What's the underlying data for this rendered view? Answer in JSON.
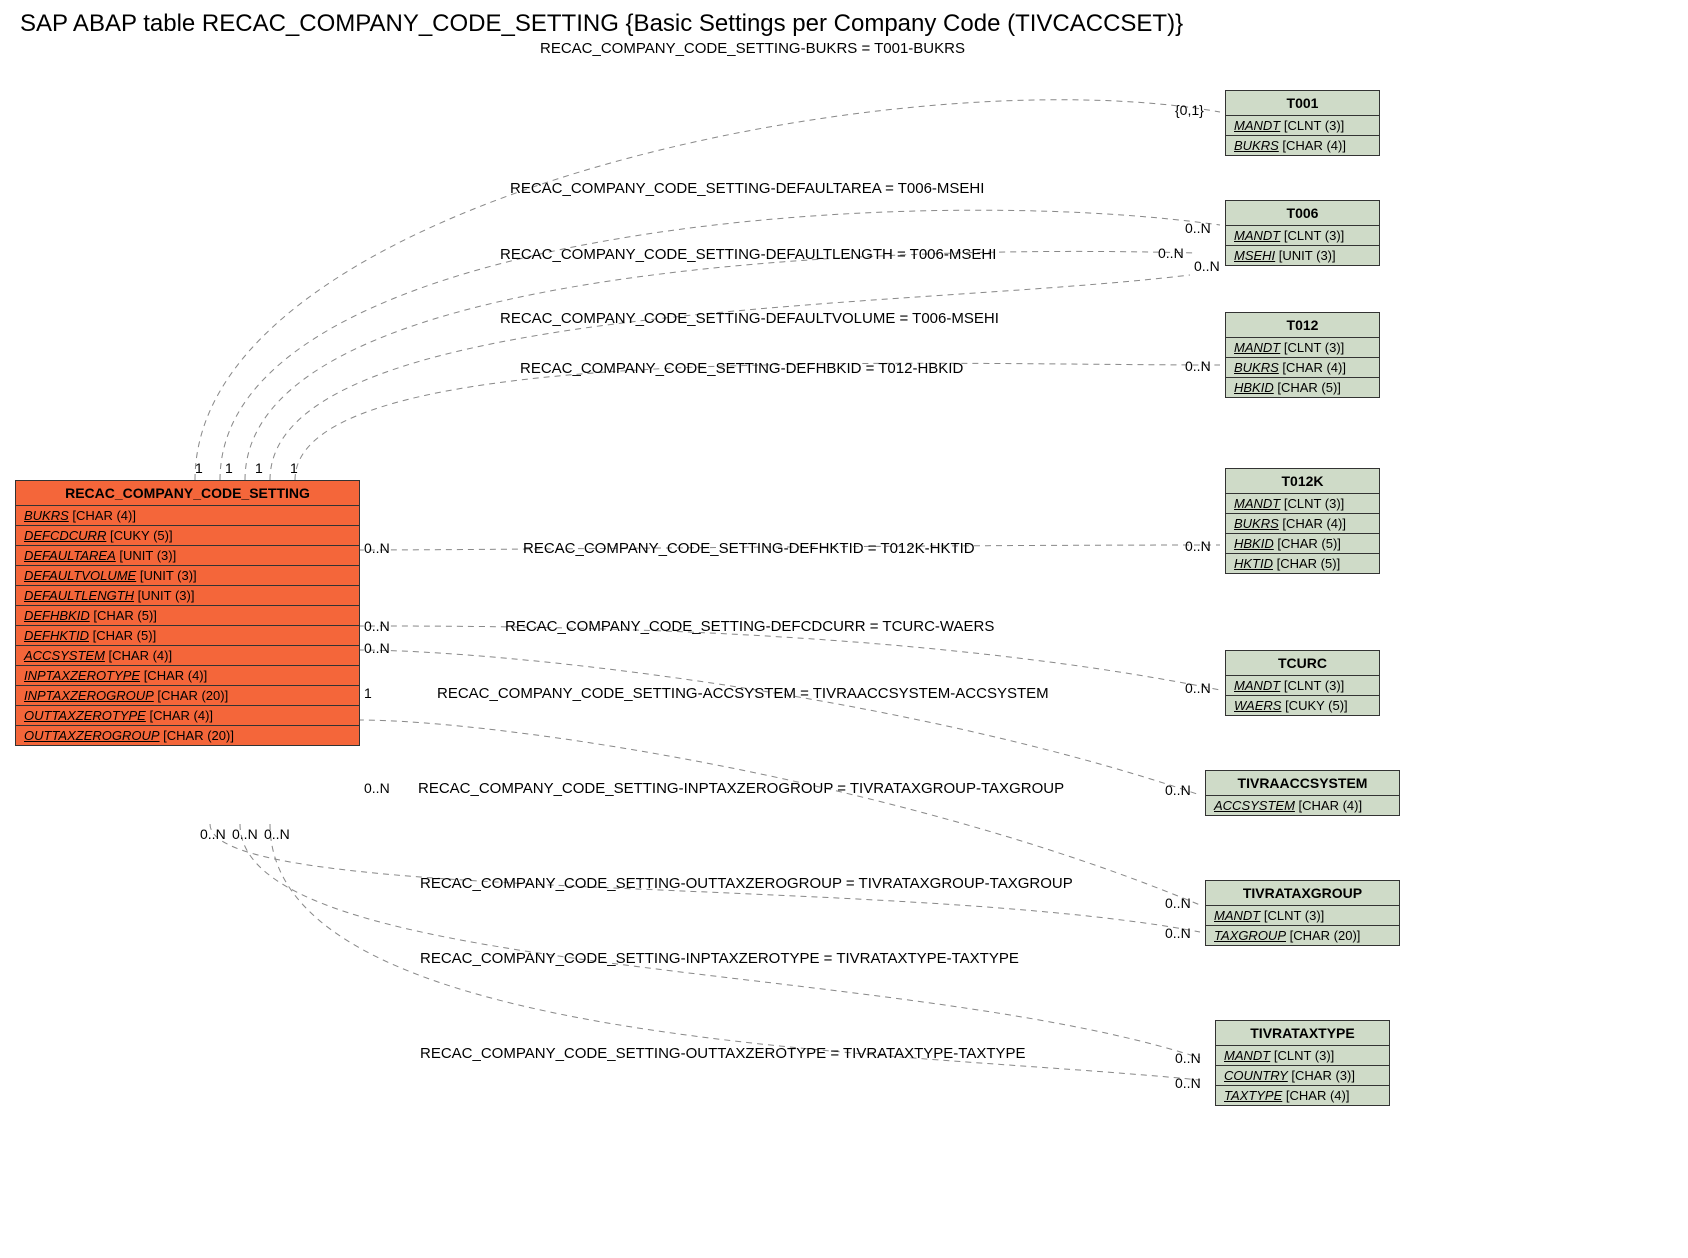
{
  "title": "SAP ABAP table RECAC_COMPANY_CODE_SETTING {Basic Settings per Company Code (TIVCACCSET)}",
  "main": {
    "name": "RECAC_COMPANY_CODE_SETTING",
    "fields": [
      {
        "name": "BUKRS",
        "type": "[CHAR (4)]"
      },
      {
        "name": "DEFCDCURR",
        "type": "[CUKY (5)]"
      },
      {
        "name": "DEFAULTAREA",
        "type": "[UNIT (3)]"
      },
      {
        "name": "DEFAULTVOLUME",
        "type": "[UNIT (3)]"
      },
      {
        "name": "DEFAULTLENGTH",
        "type": "[UNIT (3)]"
      },
      {
        "name": "DEFHBKID",
        "type": "[CHAR (5)]"
      },
      {
        "name": "DEFHKTID",
        "type": "[CHAR (5)]"
      },
      {
        "name": "ACCSYSTEM",
        "type": "[CHAR (4)]"
      },
      {
        "name": "INPTAXZEROTYPE",
        "type": "[CHAR (4)]"
      },
      {
        "name": "INPTAXZEROGROUP",
        "type": "[CHAR (20)]"
      },
      {
        "name": "OUTTAXZEROTYPE",
        "type": "[CHAR (4)]"
      },
      {
        "name": "OUTTAXZEROGROUP",
        "type": "[CHAR (20)]"
      }
    ]
  },
  "refs": {
    "t001": {
      "name": "T001",
      "fields": [
        {
          "name": "MANDT",
          "type": "[CLNT (3)]"
        },
        {
          "name": "BUKRS",
          "type": "[CHAR (4)]"
        }
      ]
    },
    "t006": {
      "name": "T006",
      "fields": [
        {
          "name": "MANDT",
          "type": "[CLNT (3)]"
        },
        {
          "name": "MSEHI",
          "type": "[UNIT (3)]"
        }
      ]
    },
    "t012": {
      "name": "T012",
      "fields": [
        {
          "name": "MANDT",
          "type": "[CLNT (3)]"
        },
        {
          "name": "BUKRS",
          "type": "[CHAR (4)]"
        },
        {
          "name": "HBKID",
          "type": "[CHAR (5)]"
        }
      ]
    },
    "t012k": {
      "name": "T012K",
      "fields": [
        {
          "name": "MANDT",
          "type": "[CLNT (3)]"
        },
        {
          "name": "BUKRS",
          "type": "[CHAR (4)]"
        },
        {
          "name": "HBKID",
          "type": "[CHAR (5)]"
        },
        {
          "name": "HKTID",
          "type": "[CHAR (5)]"
        }
      ]
    },
    "tcurc": {
      "name": "TCURC",
      "fields": [
        {
          "name": "MANDT",
          "type": "[CLNT (3)]"
        },
        {
          "name": "WAERS",
          "type": "[CUKY (5)]"
        }
      ]
    },
    "tivraaccsystem": {
      "name": "TIVRAACCSYSTEM",
      "fields": [
        {
          "name": "ACCSYSTEM",
          "type": "[CHAR (4)]"
        }
      ]
    },
    "tivrataxgroup": {
      "name": "TIVRATAXGROUP",
      "fields": [
        {
          "name": "MANDT",
          "type": "[CLNT (3)]"
        },
        {
          "name": "TAXGROUP",
          "type": "[CHAR (20)]"
        }
      ]
    },
    "tivrataxtype": {
      "name": "TIVRATAXTYPE",
      "fields": [
        {
          "name": "MANDT",
          "type": "[CLNT (3)]"
        },
        {
          "name": "COUNTRY",
          "type": "[CHAR (3)]"
        },
        {
          "name": "TAXTYPE",
          "type": "[CHAR (4)]"
        }
      ]
    }
  },
  "relations": {
    "r1": "RECAC_COMPANY_CODE_SETTING-BUKRS = T001-BUKRS",
    "r2": "RECAC_COMPANY_CODE_SETTING-DEFAULTAREA = T006-MSEHI",
    "r3": "RECAC_COMPANY_CODE_SETTING-DEFAULTLENGTH = T006-MSEHI",
    "r4": "RECAC_COMPANY_CODE_SETTING-DEFAULTVOLUME = T006-MSEHI",
    "r5": "RECAC_COMPANY_CODE_SETTING-DEFHBKID = T012-HBKID",
    "r6": "RECAC_COMPANY_CODE_SETTING-DEFHKTID = T012K-HKTID",
    "r7": "RECAC_COMPANY_CODE_SETTING-DEFCDCURR = TCURC-WAERS",
    "r8": "RECAC_COMPANY_CODE_SETTING-ACCSYSTEM = TIVRAACCSYSTEM-ACCSYSTEM",
    "r9": "RECAC_COMPANY_CODE_SETTING-INPTAXZEROGROUP = TIVRATAXGROUP-TAXGROUP",
    "r10": "RECAC_COMPANY_CODE_SETTING-OUTTAXZEROGROUP = TIVRATAXGROUP-TAXGROUP",
    "r11": "RECAC_COMPANY_CODE_SETTING-INPTAXZEROTYPE = TIVRATAXTYPE-TAXTYPE",
    "r12": "RECAC_COMPANY_CODE_SETTING-OUTTAXZEROTYPE = TIVRATAXTYPE-TAXTYPE"
  },
  "card": {
    "c01": "{0,1}",
    "cN": "0..N",
    "c1": "1"
  },
  "chart_data": {
    "type": "diagram",
    "entity": "RECAC_COMPANY_CODE_SETTING",
    "description": "Basic Settings per Company Code (TIVCACCSET)",
    "relationships": [
      {
        "from_field": "BUKRS",
        "to_table": "T001",
        "to_field": "BUKRS",
        "src_card": "1",
        "tgt_card": "{0,1}"
      },
      {
        "from_field": "DEFAULTAREA",
        "to_table": "T006",
        "to_field": "MSEHI",
        "src_card": "1",
        "tgt_card": "0..N"
      },
      {
        "from_field": "DEFAULTLENGTH",
        "to_table": "T006",
        "to_field": "MSEHI",
        "src_card": "1",
        "tgt_card": "0..N"
      },
      {
        "from_field": "DEFAULTVOLUME",
        "to_table": "T006",
        "to_field": "MSEHI",
        "src_card": "1",
        "tgt_card": "0..N"
      },
      {
        "from_field": "DEFHBKID",
        "to_table": "T012",
        "to_field": "HBKID",
        "src_card": "0..N",
        "tgt_card": "0..N"
      },
      {
        "from_field": "DEFHKTID",
        "to_table": "T012K",
        "to_field": "HKTID",
        "src_card": "0..N",
        "tgt_card": "0..N"
      },
      {
        "from_field": "DEFCDCURR",
        "to_table": "TCURC",
        "to_field": "WAERS",
        "src_card": "0..N",
        "tgt_card": "0..N"
      },
      {
        "from_field": "ACCSYSTEM",
        "to_table": "TIVRAACCSYSTEM",
        "to_field": "ACCSYSTEM",
        "src_card": "1",
        "tgt_card": "0..N"
      },
      {
        "from_field": "INPTAXZEROGROUP",
        "to_table": "TIVRATAXGROUP",
        "to_field": "TAXGROUP",
        "src_card": "0..N",
        "tgt_card": "0..N"
      },
      {
        "from_field": "OUTTAXZEROGROUP",
        "to_table": "TIVRATAXGROUP",
        "to_field": "TAXGROUP",
        "src_card": "0..N",
        "tgt_card": "0..N"
      },
      {
        "from_field": "INPTAXZEROTYPE",
        "to_table": "TIVRATAXTYPE",
        "to_field": "TAXTYPE",
        "src_card": "0..N",
        "tgt_card": "0..N"
      },
      {
        "from_field": "OUTTAXZEROTYPE",
        "to_table": "TIVRATAXTYPE",
        "to_field": "TAXTYPE",
        "src_card": "0..N",
        "tgt_card": "0..N"
      }
    ]
  }
}
